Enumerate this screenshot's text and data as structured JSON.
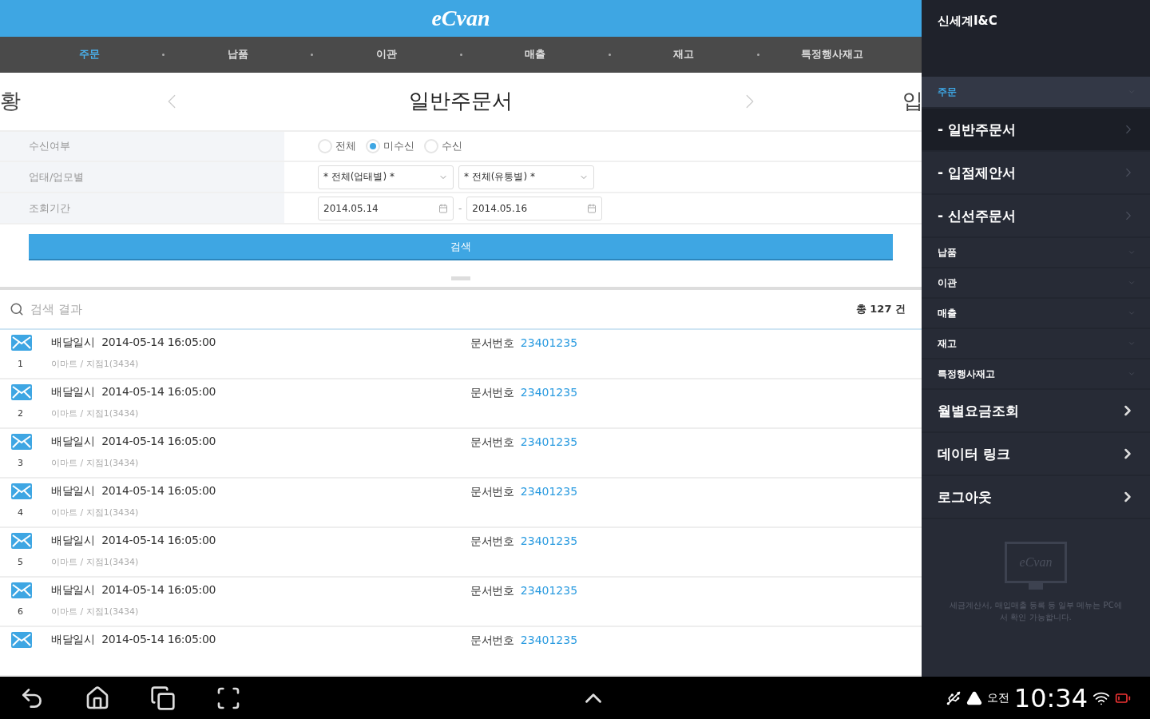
{
  "app_bar": {
    "logo": "eCvan"
  },
  "tabs": [
    {
      "label": "주문",
      "selected": true
    },
    {
      "label": "납품",
      "selected": false
    },
    {
      "label": "이관",
      "selected": false
    },
    {
      "label": "매출",
      "selected": false
    },
    {
      "label": "재고",
      "selected": false
    },
    {
      "label": "특정행사재고",
      "selected": false
    }
  ],
  "pager": {
    "previous": "황",
    "title": "일반주문서",
    "next": "입"
  },
  "filters": [
    {
      "kind": "radio",
      "label": "수신여부",
      "options": [
        {
          "label": "전체",
          "selected": false
        },
        {
          "label": "미수신",
          "selected": true
        },
        {
          "label": "수신",
          "selected": false
        }
      ]
    },
    {
      "kind": "select",
      "label": "업태/업모별",
      "values": [
        "* 전체(업태별) *",
        "* 전체(유통별) *"
      ]
    },
    {
      "kind": "date",
      "label": "조회기간",
      "values": [
        "2014.05.14",
        "2014.05.16"
      ],
      "separator": "-"
    }
  ],
  "search_button": "검색",
  "results": {
    "placeholder": "검색 결과",
    "total": "총 127 건",
    "rows": [
      {
        "number": "1",
        "date_label": "배달일시",
        "date": "2014-05-14 16:05:00",
        "doc_label": "문서번호",
        "doc": "23401235",
        "store": "이마트 / 지점1(3434)"
      },
      {
        "number": "2",
        "date_label": "배달일시",
        "date": "2014-05-14 16:05:00",
        "doc_label": "문서번호",
        "doc": "23401235",
        "store": "이마트 / 지점1(3434)"
      },
      {
        "number": "3",
        "date_label": "배달일시",
        "date": "2014-05-14 16:05:00",
        "doc_label": "문서번호",
        "doc": "23401235",
        "store": "이마트 / 지점1(3434)"
      },
      {
        "number": "4",
        "date_label": "배달일시",
        "date": "2014-05-14 16:05:00",
        "doc_label": "문서번호",
        "doc": "23401235",
        "store": "이마트 / 지점1(3434)"
      },
      {
        "number": "5",
        "date_label": "배달일시",
        "date": "2014-05-14 16:05:00",
        "doc_label": "문서번호",
        "doc": "23401235",
        "store": "이마트 / 지점1(3434)"
      },
      {
        "number": "6",
        "date_label": "배달일시",
        "date": "2014-05-14 16:05:00",
        "doc_label": "문서번호",
        "doc": "23401235",
        "store": "이마트 / 지점1(3434)"
      },
      {
        "date_label": "배달일시",
        "date": "2014-05-14 16:05:00",
        "doc_label": "문서번호",
        "doc": "23401235"
      }
    ]
  },
  "sidebar": {
    "company": "신세계I&C",
    "items": [
      {
        "kind": "section",
        "label": "주문",
        "selected": false
      },
      {
        "kind": "sub",
        "label": "- 일반주문서",
        "selected": true
      },
      {
        "kind": "sub",
        "label": "- 입점제안서",
        "selected": false
      },
      {
        "kind": "sub",
        "label": "- 신선주문서",
        "selected": false
      },
      {
        "kind": "category",
        "label": "납품",
        "selected": false
      },
      {
        "kind": "category",
        "label": "이관",
        "selected": false
      },
      {
        "kind": "category",
        "label": "매출",
        "selected": false
      },
      {
        "kind": "category",
        "label": "재고",
        "selected": false
      },
      {
        "kind": "category",
        "label": "특정행사재고",
        "selected": false
      },
      {
        "kind": "link",
        "label": "월별요금조회",
        "selected": false
      },
      {
        "kind": "link",
        "label": "데이터 링크",
        "selected": false
      },
      {
        "kind": "link",
        "label": "로그아웃",
        "selected": false
      }
    ],
    "monitor_logo": "eCvan",
    "notice": "세금계산서, 매입매출 등록 등 일부 메뉴는 PC에서 확인 가능합니다."
  },
  "status_bar": {
    "ampm": "오전",
    "time": "10:34"
  }
}
